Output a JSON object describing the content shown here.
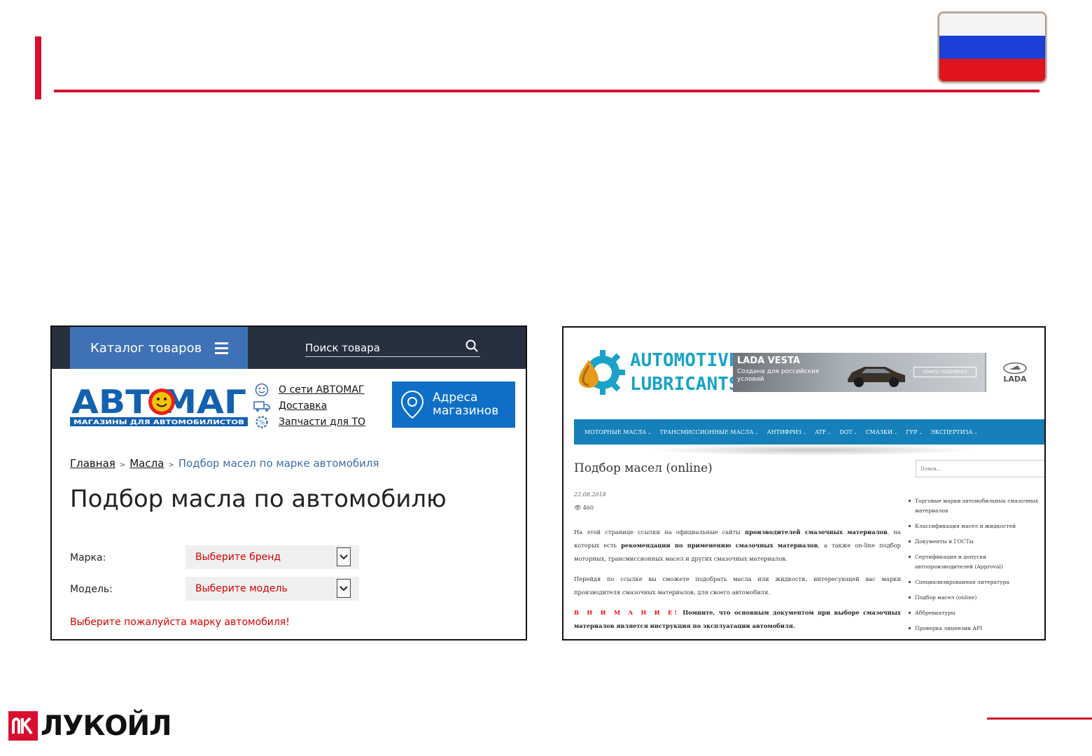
{
  "slide": {
    "flag_colors": [
      "#f4f4f4",
      "#1c3fd8",
      "#e0141c"
    ],
    "accent_color": "#d7102f",
    "brand_logo": "ЛУКОЙЛ"
  },
  "avtomag": {
    "catalog_label": "Каталог товаров",
    "search_placeholder": "Поиск товара",
    "logo_text": "АВТОМАГ",
    "logo_tagline": "МАГАЗИНЫ ДЛЯ АВТОМОБИЛИСТОВ",
    "links": [
      {
        "label": "О сети АВТОМАГ",
        "icon": "smiley-icon"
      },
      {
        "label": "Доставка",
        "icon": "truck-icon"
      },
      {
        "label": "Запчасти для ТО",
        "icon": "percent-gear-icon"
      }
    ],
    "addresses_button": [
      "Адреса",
      "магазинов"
    ],
    "breadcrumbs": {
      "home": "Главная",
      "oils": "Масла",
      "current": "Подбор масел по марке автомобиля"
    },
    "heading": "Подбор масла по автомобилю",
    "brand_label": "Марка:",
    "brand_value": "Выберите бренд",
    "model_label": "Модель:",
    "model_value": "Выберите модель",
    "warning": "Выберите пожалуйста марку автомобиля!"
  },
  "lubricants": {
    "logo_line1": "AUTOMOTIVE",
    "logo_line2": "LUBRICANTS",
    "ad": {
      "title": "LADA VESTA",
      "subtitle": "Создана для российских условий",
      "button": "УЗНАТЬ ПОДРОБНЕЕ",
      "brand": "LADA"
    },
    "nav": [
      "МОТОРНЫЕ МАСЛА",
      "ТРАНСМИССИОННЫЕ МАСЛА",
      "АНТИФРИЗ",
      "ATF",
      "DOT",
      "СМАЗКИ",
      "ГУР",
      "ЭКСПЕРТИЗА"
    ],
    "title": "Подбор масел (online)",
    "search_placeholder": "Поиск...",
    "date": "22.08.2018",
    "views": "460",
    "p1_a": "На этой странице ссылки на официальные сайты ",
    "p1_b": "производителей смазочных материалов",
    "p1_c": ", на которых есть ",
    "p1_d": "рекомендации по применению смазочных материалов",
    "p1_e": ", а также on-line подбор моторных, трансмиссионных масел и других смазочных материалов.",
    "p2": "Перейдя по ссылке вы сможете подобрать масла или жидкости, интересующей вас марки производителя смазочных материалов, для своего автомобиля.",
    "p3_att": "В Н И М А Н И Е!",
    "p3_text": " Помните, что основным документом при выборе смазочных материалов является инструкция по эксплуатации автомобиля.",
    "sidebar": [
      "Торговые марки автомобильных смазочных материалов",
      "Классификация масел и жидкостей",
      "Документы и ГОСТы",
      "Сертификация и допуски автопроизводителей (Approval)",
      "Специализированная литература",
      "Подбор масел (online)",
      "Аббревиатуры",
      "Проверка лицензии API"
    ]
  }
}
